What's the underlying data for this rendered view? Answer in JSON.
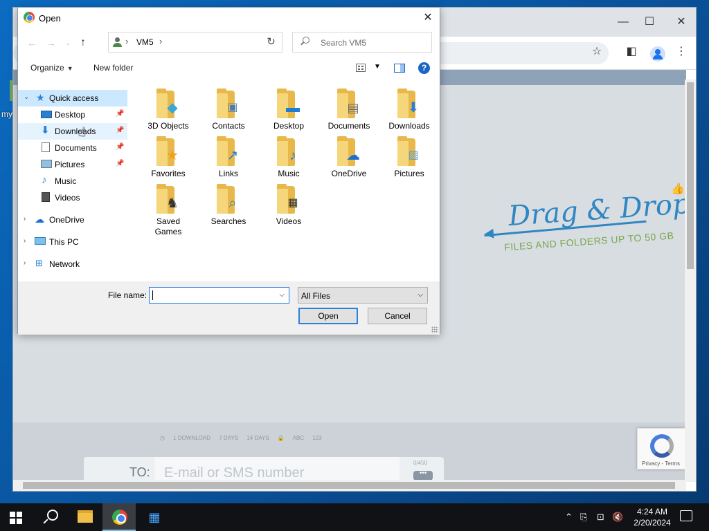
{
  "desktop": {
    "label": "my"
  },
  "browser": {
    "controls": {
      "minimize": "—",
      "maximize": "☐",
      "close": "✕"
    },
    "bookmark_icon": "star-icon",
    "page": {
      "drag_title": "Drag & Drop",
      "drag_subtitle": "FILES AND FOLDERS UP TO 50 GB",
      "options": [
        "1 DOWNLOAD",
        "7 DAYS",
        "14 DAYS",
        "ABC",
        "123"
      ],
      "to_label": "TO:",
      "to_placeholder": "E-mail or SMS number",
      "to_counter": "0/450",
      "more_label": "•••",
      "recaptcha_text": "Privacy - Terms"
    }
  },
  "dialog": {
    "title": "Open",
    "close": "✕",
    "address": {
      "location": "VM5",
      "chevron": "›"
    },
    "search_placeholder": "Search VM5",
    "toolbar": {
      "organize": "Organize",
      "new_folder": "New folder",
      "help": "?"
    },
    "nav": [
      {
        "label": "Quick access",
        "icon": "star-icon"
      },
      {
        "label": "Desktop",
        "icon": "desktop-icon",
        "pinned": true
      },
      {
        "label": "Downloads",
        "icon": "download-icon",
        "pinned": true
      },
      {
        "label": "Documents",
        "icon": "documents-icon",
        "pinned": true
      },
      {
        "label": "Pictures",
        "icon": "pictures-icon",
        "pinned": true
      },
      {
        "label": "Music",
        "icon": "music-icon"
      },
      {
        "label": "Videos",
        "icon": "videos-icon"
      },
      {
        "label": "OneDrive",
        "icon": "cloud-icon"
      },
      {
        "label": "This PC",
        "icon": "computer-icon"
      },
      {
        "label": "Network",
        "icon": "network-icon"
      }
    ],
    "files": [
      {
        "name": "3D Objects",
        "icon": "cube-icon"
      },
      {
        "name": "Contacts",
        "icon": "contact-card-icon"
      },
      {
        "name": "Desktop",
        "icon": "desktop-icon"
      },
      {
        "name": "Documents",
        "icon": "documents-icon"
      },
      {
        "name": "Downloads",
        "icon": "download-icon"
      },
      {
        "name": "Favorites",
        "icon": "star-icon"
      },
      {
        "name": "Links",
        "icon": "link-arrow-icon"
      },
      {
        "name": "Music",
        "icon": "music-icon"
      },
      {
        "name": "OneDrive",
        "icon": "cloud-icon"
      },
      {
        "name": "Pictures",
        "icon": "pictures-icon"
      },
      {
        "name": "Saved Games",
        "icon": "chess-piece-icon"
      },
      {
        "name": "Searches",
        "icon": "magnifier-icon"
      },
      {
        "name": "Videos",
        "icon": "film-icon"
      }
    ],
    "file_name_label": "File name:",
    "file_name_value": "",
    "file_type": "All Files",
    "open_button": "Open",
    "cancel_button": "Cancel"
  },
  "taskbar": {
    "time": "4:24 AM",
    "date": "2/20/2024"
  },
  "colors": {
    "accent": "#1a73e8",
    "selection": "#cce8ff",
    "folder": "#e8b94a"
  }
}
